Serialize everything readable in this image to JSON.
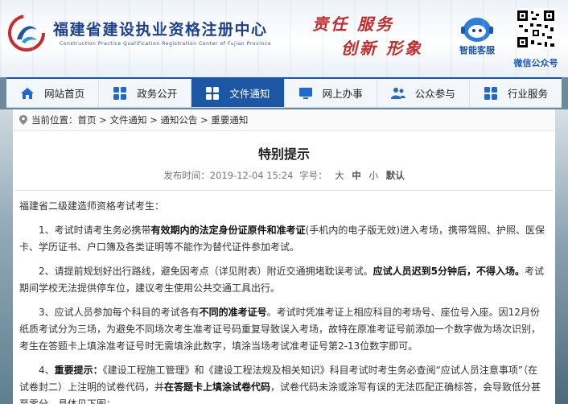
{
  "header": {
    "site_title": "福建省建设执业资格注册中心",
    "site_subtitle": "Construction Practice Qualification Registration Center of Fujian Province",
    "motto_line1": "责任 服务",
    "motto_line2": "创新 形象",
    "service_label": "智能客服",
    "wechat_label": "微信公众号"
  },
  "nav": {
    "items": [
      {
        "label": "网站首页",
        "icon": "home-icon"
      },
      {
        "label": "政务公开",
        "icon": "grid-icon"
      },
      {
        "label": "文件通知",
        "icon": "grid-icon",
        "active": true
      },
      {
        "label": "网上办事",
        "icon": "monitor-icon"
      },
      {
        "label": "公众参与",
        "icon": "people-icon"
      },
      {
        "label": "行业服务",
        "icon": "grid-icon"
      }
    ],
    "active_color": "#1e56a6"
  },
  "breadcrumb": {
    "prefix": "当前位置：",
    "items": [
      "首页",
      "文件通知",
      "通知公告",
      "重要通知"
    ],
    "separator": " > "
  },
  "article": {
    "title": "特别提示",
    "meta": {
      "published_label": "发布时间：",
      "published": "2019-12-04 15:24",
      "font_label": "字号：",
      "font_sizes": [
        "大",
        "中",
        "小"
      ],
      "default_label": "默认"
    },
    "greeting": "福建省二级建造师资格考试考生：",
    "p1": {
      "a": "1、考试时请考生务必携带",
      "b": "有效期内的法定身份证原件和准考证",
      "c": "(手机内的电子版无效)进入考场，携带驾照、护照、医保卡、学历证书、户口簿及各类证明等不能作为替代证件参加考试。"
    },
    "p2": {
      "a": "2、请提前规划好出行路线，避免因考点（详见附表）附近交通拥堵耽误考试。",
      "b": "应试人员迟到5分钟后，不得入场。",
      "c": "考试期间学校无法提供停车位，建议考生使用公共交通工具出行。"
    },
    "p3": {
      "a": "3、应试人员参加每个科目的考试各有",
      "b": "不同的准考证号",
      "c": "。考试时凭准考证上相应科目的考场号、座位号入座。因12月份纸质考试分为三场，为避免不同场次考生准考证号码重复导致误入考场，故特在原准考证号前添加一个数字做为场次识别，考生在答题卡上填涂准考证号时无需填涂此数字，填涂当场考试准考证号第2-13位数字即可。"
    },
    "p4": {
      "a": "4、",
      "b": "重要提示：",
      "c": "《建设工程施工管理》和《建设工程法规及相关知识》科目考试时考生务必查阅“应试人员注意事项”（在试卷封二）上注明的试卷代码，并",
      "d": "在答题卡上填涂试卷代码",
      "e": "，试卷代码未涂或涂写有误的无法匹配正确标答，会导致低分甚至零分。具体见下图："
    }
  }
}
